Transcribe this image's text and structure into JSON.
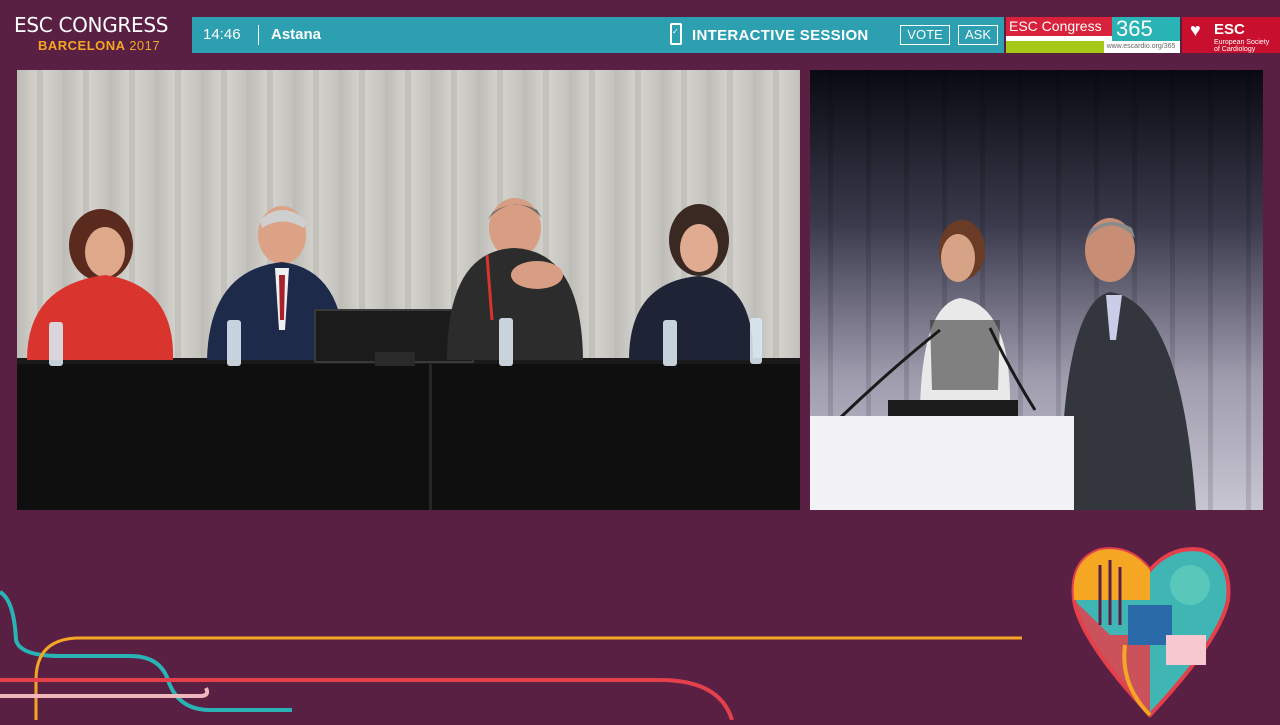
{
  "header": {
    "logo_line1": "ESC CONGRESS",
    "logo_city": "BARCELONA",
    "logo_year": "2017",
    "time": "14:46",
    "room": "Astana",
    "session_label": "INTERACTIVE SESSION",
    "vote_label": "VOTE",
    "ask_label": "ASK",
    "esc365_text": "ESC Congress",
    "esc365_number": "365",
    "esc365_url": "www.escardio.org/365",
    "society_name": "ESC",
    "society_sub": "European Society of Cardiology"
  },
  "icons": {
    "phone": "smartphone-check-icon",
    "society": "heart-logo-icon",
    "congress": "heart-graphic-icon"
  },
  "colors": {
    "background": "#5a2044",
    "bar": "#2c9fb0",
    "accent_orange": "#f5a623",
    "esc_red": "#c8102e"
  }
}
